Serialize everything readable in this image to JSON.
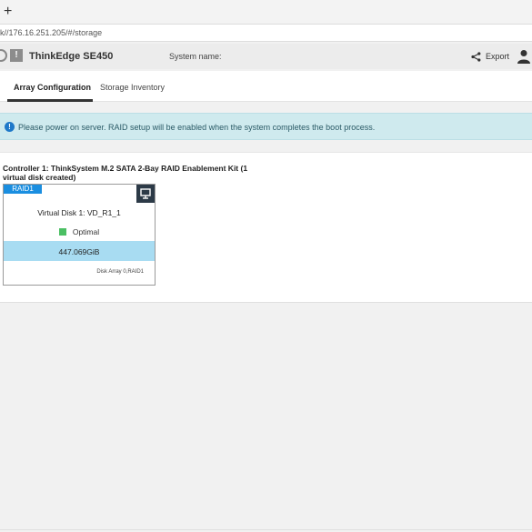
{
  "browser": {
    "new_tab_symbol": "+",
    "url": "k//176.16.251.205/#/storage"
  },
  "header": {
    "product_name": "ThinkEdge SE450",
    "alert_symbol": "!",
    "system_name_label": "System name:",
    "export_label": "Export"
  },
  "tabs": [
    {
      "label": "Array Configuration",
      "active": true
    },
    {
      "label": "Storage Inventory",
      "active": false
    }
  ],
  "banner": {
    "info_symbol": "!",
    "text": "Please power on server. RAID setup will be enabled when the system completes the boot process."
  },
  "controller": {
    "title": "Controller 1: ThinkSystem M.2 SATA 2-Bay RAID Enablement Kit (1 virtual disk created)"
  },
  "virtual_disk": {
    "raid_level": "RAID1",
    "name": "Virtual Disk 1: VD_R1_1",
    "status": "Optimal",
    "capacity": "447.069GiB",
    "array_info": "Disk Array 0,RAID1"
  },
  "colors": {
    "accent_blue": "#1a8ee0",
    "info_banner": "#cfeaee",
    "capacity_fill": "#a8dcf2",
    "status_optimal": "#4bbf63",
    "monitor_button": "#2c3a47"
  },
  "icons": [
    "power-icon",
    "alert-icon",
    "share-icon",
    "user-icon",
    "info-icon",
    "monitor-icon"
  ]
}
